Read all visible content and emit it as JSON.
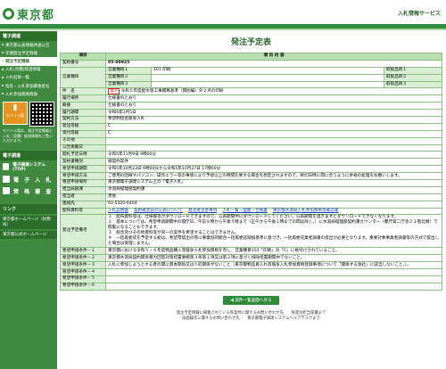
{
  "header": {
    "logo_text": "東京都",
    "service_title": "入札情報サービス"
  },
  "sidebar": {
    "section1": "電子調達",
    "items": [
      "東京都公表情報共通公告",
      "年間発注予定情報",
      "発注予定情報",
      "入札(見積)経過情報",
      "入札結果一覧",
      "指名・入札参加資格者名",
      "入札参加資格情報"
    ],
    "mobile_label": "モバイル版",
    "mobile_note": "モバイル版は、発注予定情報と入札（見積）経過情報をご覧いただけます。",
    "section2": "電子調達",
    "big_items": [
      "電子調達システム(TOP)",
      "電 子 入 札",
      "資 格 審 査"
    ],
    "section3": "リンク",
    "links": [
      "東京都ホームページ（財務局）",
      "東京都公式ホームページ"
    ]
  },
  "page_title": "発注予定表",
  "table": {
    "head_item": "項目",
    "head_content": "項 目 内 容",
    "contract_no_label": "契約番号",
    "contract_no": "05-00925",
    "biz_label": "営業種目",
    "biz": [
      {
        "name": "営業種目１",
        "value": "101 印刷",
        "cat": "取扱品目１"
      },
      {
        "name": "営業種目２",
        "value": "",
        "cat": "取扱品目２"
      },
      {
        "name": "営業種目３",
        "value": "",
        "cat": "取扱品目３"
      }
    ],
    "rows": [
      {
        "label": "件　名",
        "tag": "電子",
        "value": "令和５年度配水管工事積算基準（開削編）外２点の印刷"
      },
      {
        "label": "履行場所",
        "value": "仕様書のとおり"
      },
      {
        "label": "概要",
        "value": "仕様書のとおり"
      },
      {
        "label": "履行期間",
        "value": "令和6年1月5日"
      },
      {
        "label": "契約方法",
        "value": "希望制指名競争入札"
      },
      {
        "label": "発注等級",
        "value": "C"
      },
      {
        "label": "受付等級",
        "value": "C"
      },
      {
        "label": "その他",
        "value": ""
      },
      {
        "label": "公告掲載日",
        "value": ""
      },
      {
        "label": "開札予定日時",
        "value": "令和5年11月9日 9時00分"
      },
      {
        "label": "契約書種別",
        "value": "紙契約案件"
      },
      {
        "label": "希望申請期間",
        "value": "令和5年10月23日 9時00分から令和5年10月27日 17時00分"
      },
      {
        "label": "希望申請方法",
        "value": "ご使用の回線やパソコン、操作エラー等の事情により予想以上の時間を要する場合を想定されますので、締切日時に間に合うように余裕の処理をお願いします。"
      },
      {
        "label": "希望申請場所",
        "value": "東京都電子調達システム上の「電子入札」"
      },
      {
        "label": "担当局部課",
        "value": "水道局経理部契約課"
      },
      {
        "label": "担当者",
        "value": "黒佐"
      },
      {
        "label": "連絡先",
        "value": "03-5320-6404"
      }
    ],
    "docs_label": "配布資料等",
    "docs": [
      "入札説明書",
      "契約確定日の公表について",
      "発注者注意事項",
      "入札一覧・図面・仕様書",
      "東京都水道局入札参加資格等確認書"
    ],
    "remarks_label": "発注予定備考",
    "remarks": [
      "１　配布資料等は、仕様書等がダウンロードできますので、公表期間中にダウンロードしてください。公表期間を過ぎますとダウンロードできなくなります。",
      "２　基本については、希望申請期間中の開庁日、午前９時から午後５時まで（正午から午後１時までの間は除く。）に水道局経理部契約課カウンター（都庁第二庁舎２１階北側）で閲覧になることもできます。",
      "３　総合及びその他資料等が同一の案件を希望することはできません。",
      "４　一括再委託を予定する総は、希望票提出の際に事業協同組合一括再委託取扱基準に基づき、一括再委託業者調書の提出が必要となります。重要対象事業者調書等の方式で提出した場合は受理しません。"
    ],
    "cond_rows": [
      {
        "label": "希望申請条件－１",
        "value": "東京都における令和５・６年度物品購入等競争入札参加資格を有し、営業種目101「印刷」の「C」に格付けされていること。"
      },
      {
        "label": "希望申請条件－２",
        "value": "東京都水道局契約関係暴力団等対策措置要綱第３条第１項又は第２項に基づく排除措置期間中でないこと。"
      },
      {
        "label": "希望申請条件－３",
        "value": "入札に参加しようとする者の間に資本関係又は人的関係がないこと（東京都物品買入れ等競争入札参加資格登録事項について「関係する会社」に該当しないこと。）。"
      },
      {
        "label": "希望申請条件－４",
        "value": ""
      },
      {
        "label": "希望申請条件－５",
        "value": ""
      },
      {
        "label": "希望申請条件－６",
        "value": ""
      }
    ]
  },
  "back_button": "案件一覧画面へ戻る",
  "footer": {
    "line1": "発注予定情報に掲載されている各案件に関するお問い合わせ先　　各発注担当部署まで",
    "line2": "画面操作に関するお問い合わせ先　　東京都電子調達システムヘルプデスクまで"
  }
}
